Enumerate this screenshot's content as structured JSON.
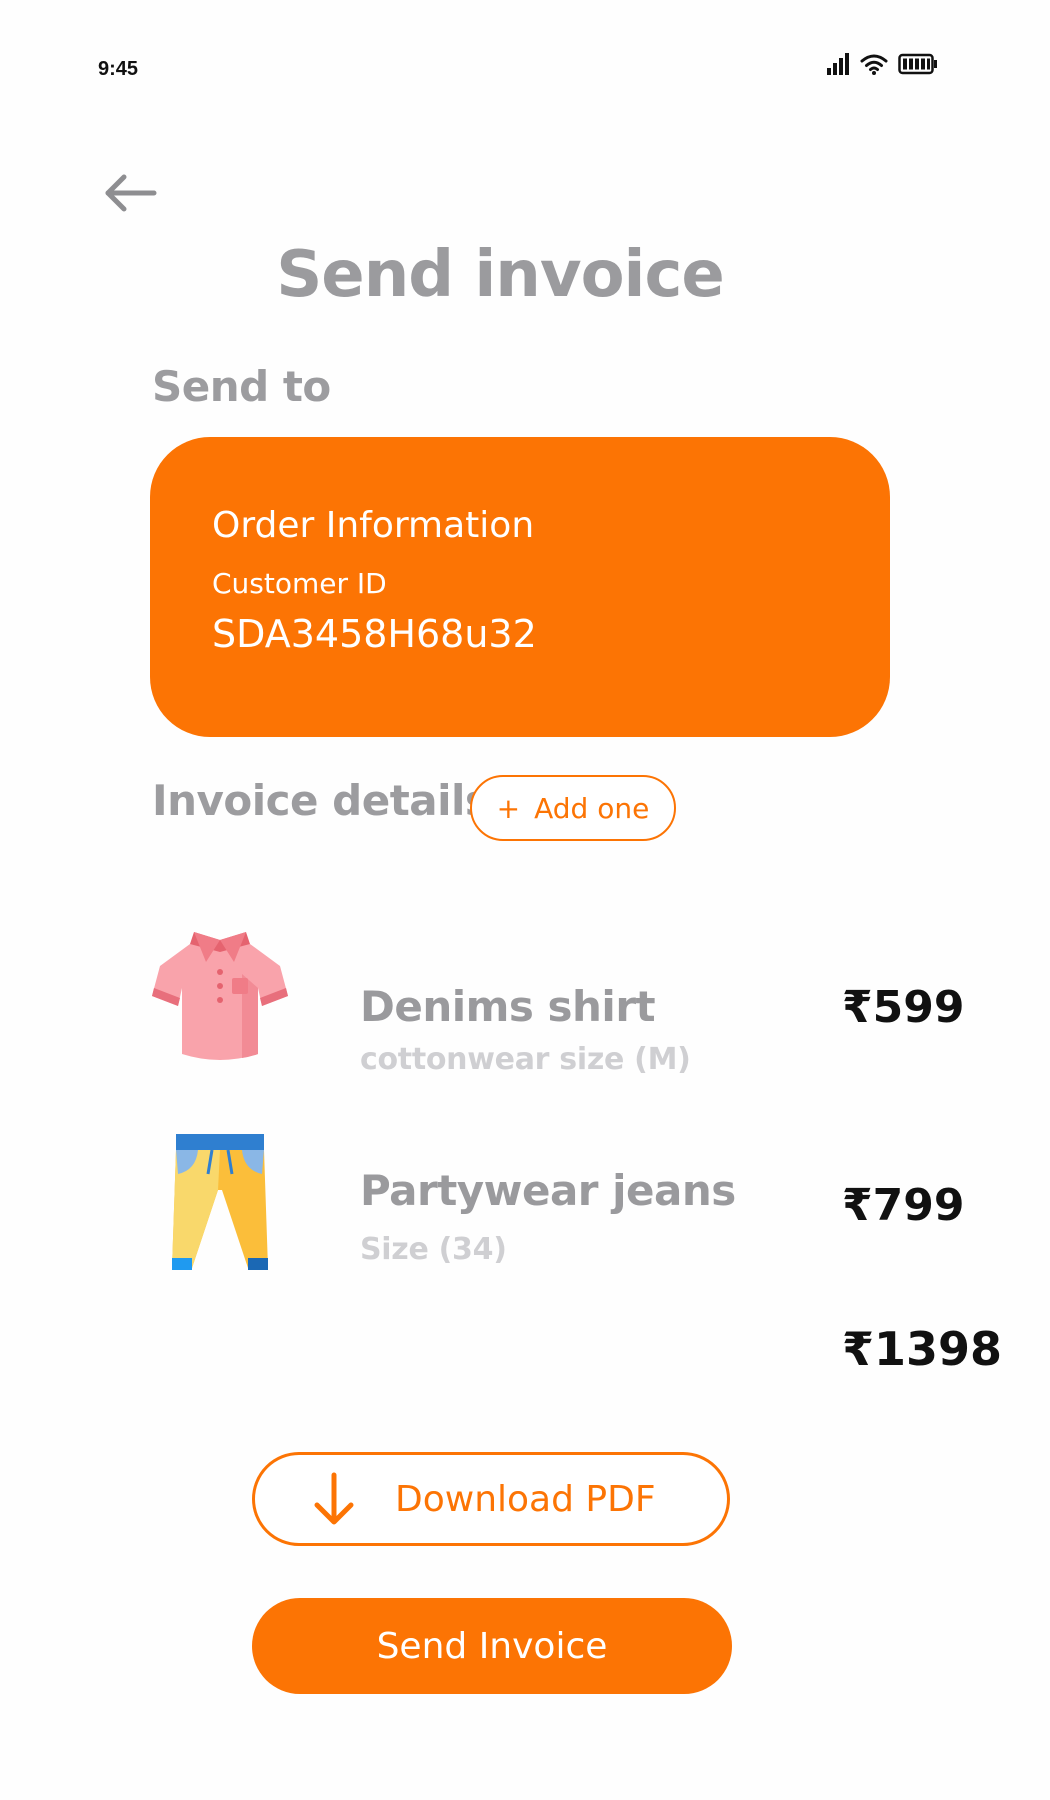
{
  "status_bar": {
    "time": "9:45"
  },
  "header": {
    "back_icon": "arrow-left-icon",
    "title": "Send invoice"
  },
  "send_to": {
    "label": "Send to",
    "card": {
      "title": "Order Information",
      "customer_id_label": "Customer ID",
      "customer_id_value": "SDA3458H68u32",
      "background": "#fc7404"
    }
  },
  "invoice": {
    "label": "Invoice details",
    "add_button": {
      "plus": "+",
      "label": "Add one"
    },
    "items": [
      {
        "icon": "shirt-icon",
        "name": "Denims shirt",
        "sub": "cottonwear size (M)",
        "price": "₹599"
      },
      {
        "icon": "jeans-icon",
        "name": "Partywear jeans",
        "sub": "Size (34)",
        "price": "₹799"
      }
    ],
    "total": "₹1398"
  },
  "actions": {
    "download_label": "Download PDF",
    "download_icon": "download-arrow-icon",
    "send_label": "Send Invoice"
  },
  "colors": {
    "accent": "#fc7404",
    "title_gray": "#9b9b9e",
    "sub_gray": "#cfcfd2"
  }
}
